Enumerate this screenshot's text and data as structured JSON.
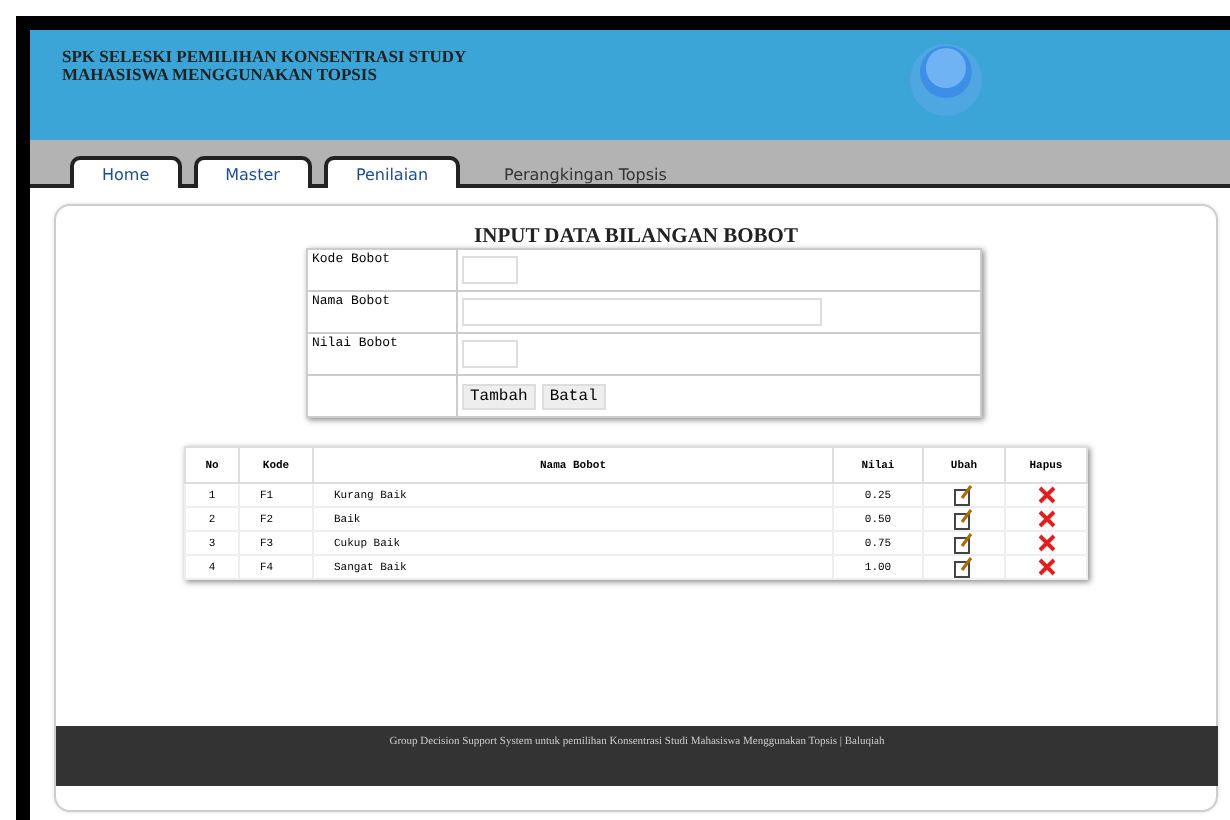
{
  "header": {
    "title_lines": [
      "SPK SELESKI PEMILIHAN KONSENTRASI STUDY",
      "MAHASISWA MENGGUNAKAN TOPSIS"
    ]
  },
  "tabs": [
    {
      "label": "Home",
      "kind": "tab"
    },
    {
      "label": "Master",
      "kind": "tab"
    },
    {
      "label": "Penilaian",
      "kind": "tab"
    },
    {
      "label": "Perangkingan Topsis",
      "kind": "plain"
    }
  ],
  "form": {
    "title": "INPUT DATA BILANGAN BOBOT",
    "fields": [
      {
        "label": "Kode Bobot",
        "kind": "short"
      },
      {
        "label": "Nama Bobot",
        "kind": "long"
      },
      {
        "label": "Nilai Bobot",
        "kind": "short"
      }
    ],
    "buttons": [
      "Tambah",
      "Batal"
    ]
  },
  "table": {
    "columns": [
      "No",
      "Kode",
      "Nama Bobot",
      "Nilai",
      "Ubah",
      "Hapus"
    ],
    "rows": [
      [
        "1",
        "F1",
        "Kurang Baik",
        "0.25"
      ],
      [
        "2",
        "F2",
        "Baik",
        "0.50"
      ],
      [
        "3",
        "F3",
        "Cukup Baik",
        "0.75"
      ],
      [
        "4",
        "F4",
        "Sangat Baik",
        "1.00"
      ]
    ]
  },
  "footer": "Group Decision Support System untuk pemilihan Konsentrasi Studi Mahasiswa Menggunakan Topsis | Baluqiah"
}
